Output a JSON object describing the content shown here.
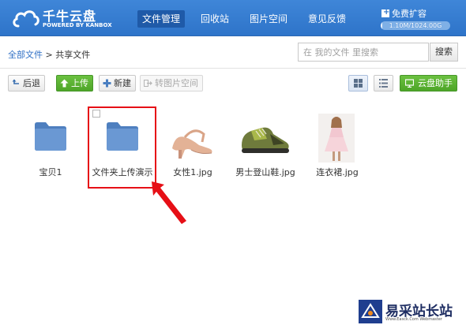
{
  "header": {
    "logo_title": "千牛云盘",
    "logo_sub": "POWERED BY KANBOX",
    "nav": [
      {
        "label": "文件管理",
        "active": true
      },
      {
        "label": "回收站",
        "active": false
      },
      {
        "label": "图片空间",
        "active": false
      },
      {
        "label": "意见反馈",
        "active": false
      }
    ],
    "expand_label": "免费扩容",
    "quota_text": "1.10M/1024.00G",
    "quota_fraction": 0.001
  },
  "breadcrumb": {
    "root": "全部文件",
    "separator": ">",
    "current": "共享文件"
  },
  "search": {
    "placeholder": "在 我的文件 里搜索",
    "button_label": "搜索"
  },
  "toolbar": {
    "back_label": "后退",
    "upload_label": "上传",
    "new_label": "新建",
    "to_image_space_label": "转图片空间",
    "assistant_label": "云盘助手"
  },
  "files": [
    {
      "name": "宝贝1",
      "type": "folder"
    },
    {
      "name": "文件夹上传演示",
      "type": "folder"
    },
    {
      "name": "女性1.jpg",
      "type": "image"
    },
    {
      "name": "男士登山鞋.jpg",
      "type": "image"
    },
    {
      "name": "连衣裙.jpg",
      "type": "image"
    }
  ],
  "watermark": {
    "text": "易采站长站",
    "sub": "Www.Easck.Com Webmaster"
  },
  "colors": {
    "header_bg": "#3f86d8",
    "nav_active": "#1f5aa8",
    "green_button": "#5bb332",
    "highlight_red": "#e60f16",
    "folder_blue": "#5a88c6"
  }
}
